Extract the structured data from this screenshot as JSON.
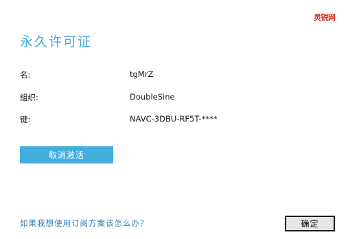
{
  "watermark": "灵锐网",
  "title": "永久许可证",
  "fields": {
    "name": {
      "label": "名:",
      "value": "tgMrZ"
    },
    "organization": {
      "label": "組织:",
      "value": "DoubleSine"
    },
    "key": {
      "label": "键:",
      "value": "NAVC-3DBU-RF5T-****"
    }
  },
  "buttons": {
    "deactivate": "取消激活",
    "ok": "确定"
  },
  "help_link": "如果我想使用订阅方案该怎么办？",
  "colors": {
    "accent": "#43aede",
    "title": "#46a8d8",
    "link": "#2d7fb8",
    "watermark": "#d52b1e"
  }
}
